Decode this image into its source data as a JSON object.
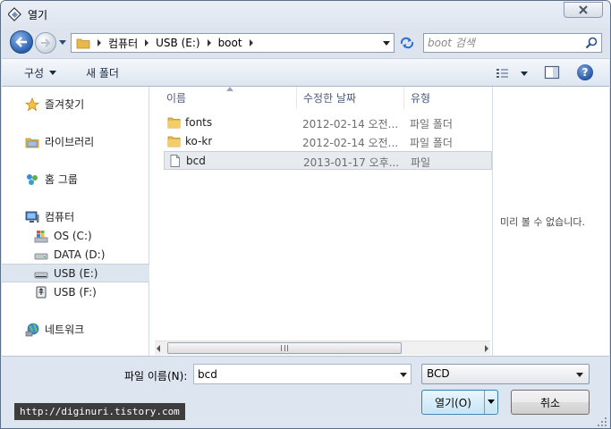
{
  "window": {
    "title": "열기"
  },
  "address": {
    "crumbs": [
      "컴퓨터",
      "USB (E:)",
      "boot"
    ]
  },
  "search": {
    "placeholder": "boot 검색"
  },
  "toolbar": {
    "organize_label": "구성",
    "new_folder_label": "새 폴더",
    "help_label": "?"
  },
  "nav": {
    "favorites": "즐겨찾기",
    "libraries": "라이브러리",
    "homegroup": "홈 그룹",
    "computer": "컴퓨터",
    "drives": [
      {
        "label": "OS (C:)"
      },
      {
        "label": "DATA (D:)"
      },
      {
        "label": "USB (E:)"
      },
      {
        "label": "USB (F:)"
      }
    ],
    "network": "네트워크"
  },
  "file_list": {
    "columns": {
      "name": "이름",
      "date": "수정한 날짜",
      "type": "유형"
    },
    "rows": [
      {
        "name": "fonts",
        "date": "2012-02-14 오전...",
        "type": "파일 폴더",
        "kind": "folder"
      },
      {
        "name": "ko-kr",
        "date": "2012-02-14 오전...",
        "type": "파일 폴더",
        "kind": "folder"
      },
      {
        "name": "bcd",
        "date": "2013-01-17 오후...",
        "type": "파일",
        "kind": "file"
      }
    ]
  },
  "preview": {
    "empty_text": "미리 볼 수 없습니다."
  },
  "bottom": {
    "filename_label": "파일 이름(N):",
    "filename_value": "bcd",
    "filetype_value": "BCD",
    "open_label": "열기(O)",
    "cancel_label": "취소"
  },
  "watermark": "http://diginuri.tistory.com",
  "colors": {
    "accent": "#2a5fae",
    "selection": "#dde5ef",
    "folder": "#e8b84a"
  }
}
